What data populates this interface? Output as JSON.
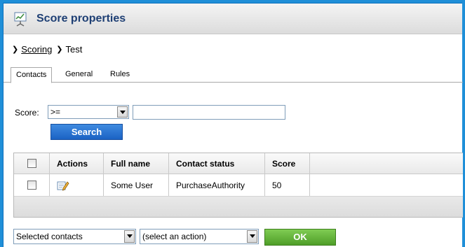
{
  "window": {
    "title": "Score properties",
    "title_icon": "chart-presentation-icon"
  },
  "breadcrumb": {
    "parent": "Scoring",
    "current": "Test"
  },
  "tabs": [
    {
      "label": "Contacts",
      "active": true
    },
    {
      "label": "General",
      "active": false
    },
    {
      "label": "Rules",
      "active": false
    }
  ],
  "filter": {
    "label": "Score:",
    "operator_selected": ">=",
    "value": "",
    "search_label": "Search"
  },
  "grid": {
    "columns": [
      "Actions",
      "Full name",
      "Contact status",
      "Score"
    ],
    "rows": [
      {
        "checked": false,
        "action_icon": "edit-icon",
        "full_name": "Some User",
        "contact_status": "PurchaseAuthority",
        "score": "50"
      }
    ]
  },
  "mass_action": {
    "scope_selected": "Selected contacts",
    "action_selected": "(select an action)",
    "ok_label": "OK"
  },
  "colors": {
    "background": "#1f8fd8",
    "title_text": "#1e3f74",
    "search_button": "#2a74d4",
    "ok_button": "#5cac33"
  }
}
